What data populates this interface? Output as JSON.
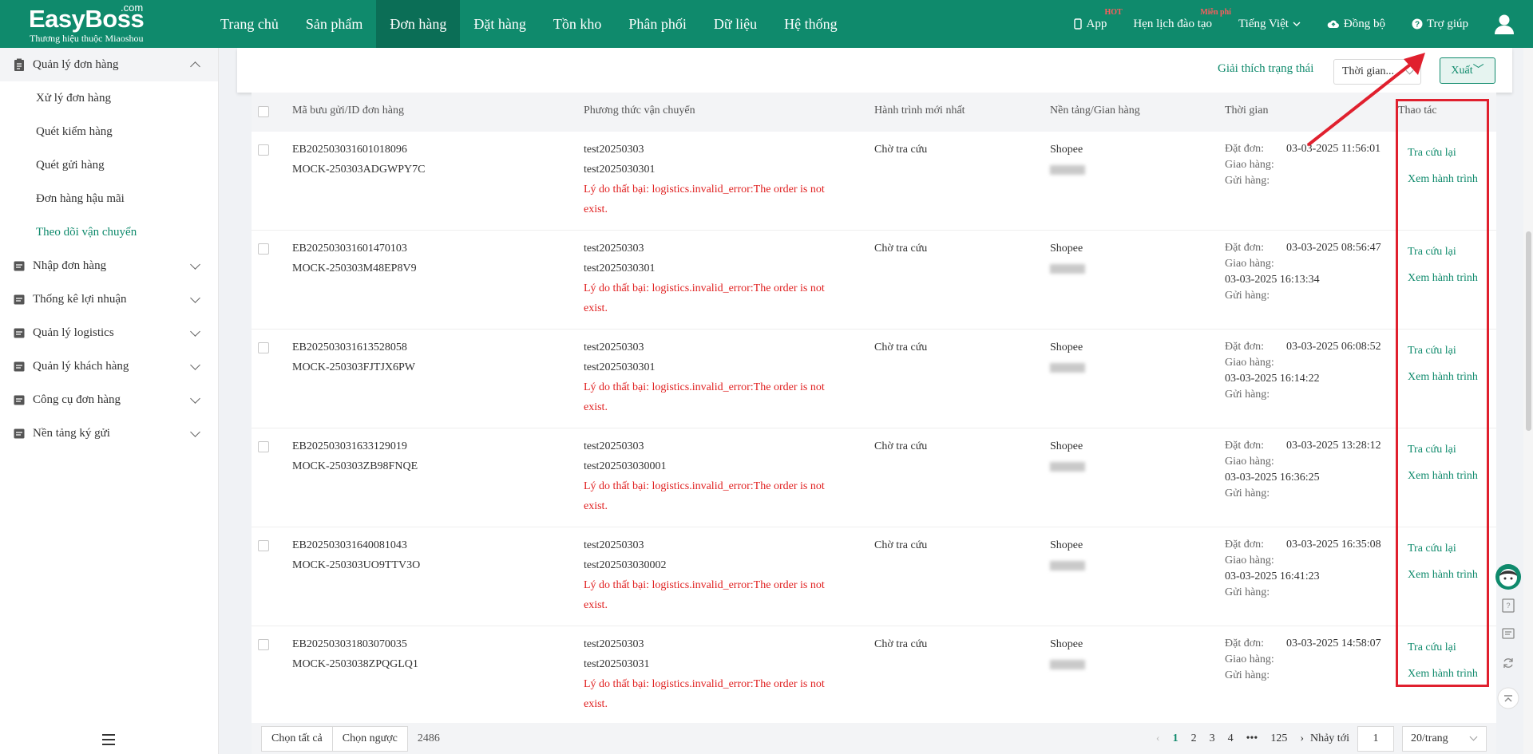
{
  "brand": {
    "name": "EasyBoss",
    "com": ".com",
    "subtitle": "Thương hiệu thuộc Miaoshou"
  },
  "nav": [
    "Trang chủ",
    "Sản phẩm",
    "Đơn hàng",
    "Đặt hàng",
    "Tồn kho",
    "Phân phối",
    "Dữ liệu",
    "Hệ thống"
  ],
  "nav_active": "Đơn hàng",
  "topright": {
    "app": "App",
    "app_badge": "HOT",
    "training": "Hẹn lịch đào tạo",
    "training_badge": "Miễn phí",
    "language": "Tiếng Việt",
    "sync": "Đồng bộ",
    "help": "Trợ giúp"
  },
  "sidebar": {
    "group_open": "Quản lý đơn hàng",
    "subs": [
      "Xử lý đơn hàng",
      "Quét kiểm hàng",
      "Quét gửi hàng",
      "Đơn hàng hậu mãi",
      "Theo dõi vận chuyển"
    ],
    "sub_active": "Theo dõi vận chuyển",
    "groups": [
      "Nhập đơn hàng",
      "Thống kê lợi nhuận",
      "Quản lý logistics",
      "Quản lý khách hàng",
      "Công cụ đơn hàng",
      "Nền tảng ký gửi"
    ]
  },
  "toolbar": {
    "status_link": "Giải thích trạng thái",
    "time_select": "Thời gian...",
    "export": "Xuất"
  },
  "columns": [
    "Mã bưu gửi/ID đơn hàng",
    "Phương thức vận chuyển",
    "Hành trình mới nhất",
    "Nền tảng/Gian hàng",
    "Thời gian",
    "Thao tác"
  ],
  "time_labels": {
    "order": "Đặt đơn:",
    "delivery": "Giao hàng:",
    "ship": "Gửi hàng:"
  },
  "actions": {
    "retry": "Tra cứu lại",
    "track": "Xem hành trình"
  },
  "rows": [
    {
      "id": "EB202503031601018096",
      "mock": "MOCK-250303ADGWPY7C",
      "m1": "test20250303",
      "m2": "test2025030301",
      "err": "Lý do thất bại: logistics.invalid_error:The order is not exist.",
      "status": "Chờ tra cứu",
      "platform": "Shopee",
      "order_time": "03-03-2025 11:56:01",
      "delivery_time": ""
    },
    {
      "id": "EB202503031601470103",
      "mock": "MOCK-250303M48EP8V9",
      "m1": "test20250303",
      "m2": "test2025030301",
      "err": "Lý do thất bại: logistics.invalid_error:The order is not exist.",
      "status": "Chờ tra cứu",
      "platform": "Shopee",
      "order_time": "03-03-2025 08:56:47",
      "delivery_time": "03-03-2025 16:13:34"
    },
    {
      "id": "EB202503031613528058",
      "mock": "MOCK-250303FJTJX6PW",
      "m1": "test20250303",
      "m2": "test2025030301",
      "err": "Lý do thất bại: logistics.invalid_error:The order is not exist.",
      "status": "Chờ tra cứu",
      "platform": "Shopee",
      "order_time": "03-03-2025 06:08:52",
      "delivery_time": "03-03-2025 16:14:22"
    },
    {
      "id": "EB202503031633129019",
      "mock": "MOCK-250303ZB98FNQE",
      "m1": "test20250303",
      "m2": "test202503030001",
      "err": "Lý do thất bại: logistics.invalid_error:The order is not exist.",
      "status": "Chờ tra cứu",
      "platform": "Shopee",
      "order_time": "03-03-2025 13:28:12",
      "delivery_time": "03-03-2025 16:36:25"
    },
    {
      "id": "EB202503031640081043",
      "mock": "MOCK-250303UO9TTV3O",
      "m1": "test20250303",
      "m2": "test202503030002",
      "err": "Lý do thất bại: logistics.invalid_error:The order is not exist.",
      "status": "Chờ tra cứu",
      "platform": "Shopee",
      "order_time": "03-03-2025 16:35:08",
      "delivery_time": "03-03-2025 16:41:23"
    },
    {
      "id": "EB202503031803070035",
      "mock": "MOCK-2503038ZPQGLQ1",
      "m1": "test20250303",
      "m2": "test202503031",
      "err": "Lý do thất bại: logistics.invalid_error:The order is not exist.",
      "status": "Chờ tra cứu",
      "platform": "Shopee",
      "order_time": "03-03-2025 14:58:07",
      "delivery_time": ""
    }
  ],
  "footer": {
    "select_all": "Chọn tất cả",
    "invert": "Chọn ngược",
    "total": "2486",
    "pages": [
      "1",
      "2",
      "3",
      "4"
    ],
    "ellipsis": "•••",
    "last": "125",
    "goto_label": "Nhảy tới",
    "goto_value": "1",
    "per_page": "20/trang"
  },
  "colors": {
    "brand": "#0f8a6c",
    "error": "#e02020",
    "highlight": "#e0202e"
  }
}
